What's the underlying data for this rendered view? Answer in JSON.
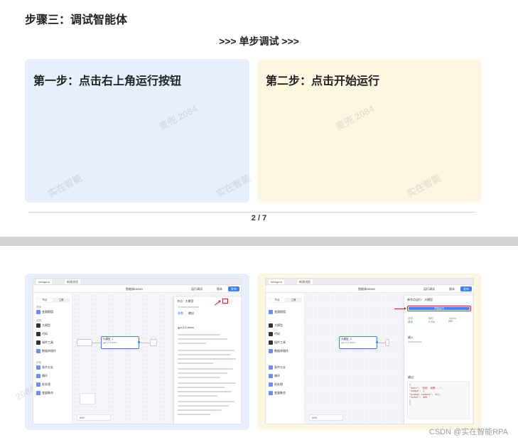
{
  "section_title": "步骤三：调试智能体",
  "subtitle": ">>> 单步调试 >>>",
  "cards": [
    {
      "title": "第一步：点击右上角运行按钮"
    },
    {
      "title": "第二步：点击开始运行"
    }
  ],
  "watermarks": [
    "麦兜 2084",
    "实在智能",
    "麦兜 2084",
    "实在智能",
    "2084"
  ],
  "pager": "2 / 7",
  "footer": "CSDN @实在智能RPA",
  "screenshot1": {
    "tabs": [
      "lobAgent",
      "新建流程"
    ],
    "title": "智能体DEMO",
    "toolbar_buttons": [
      "运行调试",
      "版本",
      "发布"
    ],
    "left_tabs": [
      "节点",
      "工具"
    ],
    "left_groups": [
      "基础",
      "逻辑",
      "其他"
    ],
    "left_items": [
      "变量赋值",
      "大模型",
      "代码",
      "插件工具",
      "数据库操作",
      "条件分支",
      "循环",
      "批处理",
      "变量聚合"
    ],
    "node_main": "大模型_1",
    "node_main_sub": "gpt-3.5-turbo",
    "panel_title": "节点 · 大模型",
    "panel_tabs": [
      "参数",
      "输出"
    ],
    "panel_model": "gpt-3.5-turbo",
    "zoom": "84%"
  },
  "screenshot2": {
    "tabs": [
      "lobAgent",
      "新建流程"
    ],
    "title": "智能体DEMO",
    "toolbar_buttons": [
      "运行调试",
      "版本",
      "发布"
    ],
    "left_tabs": [
      "节点",
      "工具"
    ],
    "left_items": [
      "变量赋值",
      "大模型",
      "代码",
      "插件工具",
      "数据库操作",
      "条件分支",
      "循环",
      "批处理",
      "变量聚合"
    ],
    "node_main": "大模型_1",
    "node_main_sub": "gpt-3.5-turbo",
    "panel_title": "单节点运行：大模型",
    "run_button": "开始运行",
    "stats": [
      {
        "label": "状态",
        "value": "成功"
      },
      {
        "label": "耗时",
        "value": "2.32s"
      },
      {
        "label": "Tokens",
        "value": "589"
      }
    ],
    "input_label": "输入",
    "output_label": "输出",
    "code_lines": [
      "{",
      "  \"text\": \"你好，我是...\",",
      "  \"usage\": {",
      "    \"prompt_tokens\": 311,",
      "    \"total\": 589",
      "  }",
      "}"
    ],
    "zoom": "84%"
  },
  "colors": {
    "card_blue": "#e6effb",
    "card_yellow": "#fdf7e1",
    "accent_blue": "#3b82f6",
    "highlight_red": "#e02020",
    "band_gray": "#d3d3d3"
  }
}
